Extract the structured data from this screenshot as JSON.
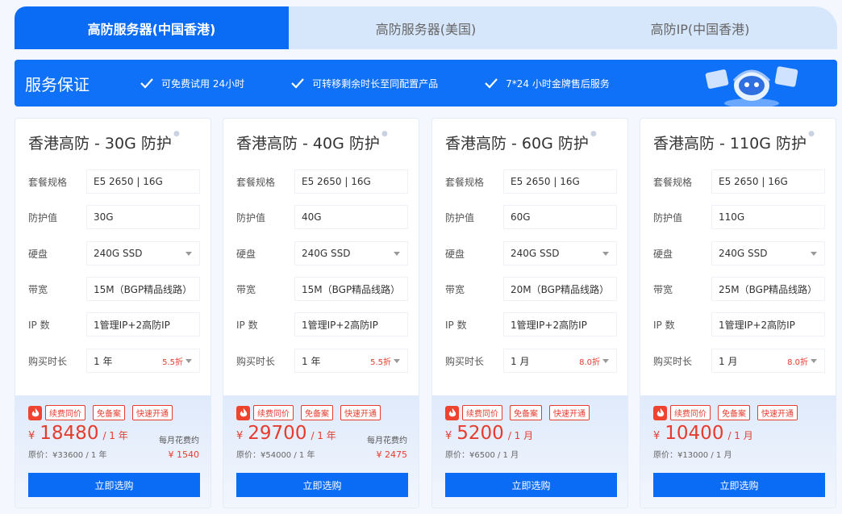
{
  "tabs": [
    "高防服务器(中国香港)",
    "高防服务器(美国)",
    "高防IP(中国香港)"
  ],
  "banner": {
    "title": "服务保证",
    "items": [
      "可免费试用 24小时",
      "可转移剩余时长至同配置产品",
      "7*24 小时金牌售后服务"
    ]
  },
  "labels": {
    "spec": "套餐规格",
    "protect": "防护值",
    "disk": "硬盘",
    "bandwidth": "带宽",
    "ip": "IP 数",
    "duration": "购买时长"
  },
  "badges": [
    "续费同价",
    "免备案",
    "快速开通"
  ],
  "currency": "¥",
  "buy_label": "立即选购",
  "monthly_label": "每月花费约",
  "cards": [
    {
      "title": "香港高防 - 30G 防护",
      "spec": "E5 2650 | 16G",
      "protect": "30G",
      "disk": "240G SSD",
      "bandwidth": "15M（BGP精品线路）",
      "ip": "1管理IP+2高防IP",
      "duration": "1 年",
      "discount": "5.5折",
      "price": "18480",
      "per": "/ 1 年",
      "original": "原价：¥33600 / 1 年",
      "monthly": "¥ 1540"
    },
    {
      "title": "香港高防 - 40G 防护",
      "spec": "E5 2650 | 16G",
      "protect": "40G",
      "disk": "240G SSD",
      "bandwidth": "15M（BGP精品线路）",
      "ip": "1管理IP+2高防IP",
      "duration": "1 年",
      "discount": "5.5折",
      "price": "29700",
      "per": "/ 1 年",
      "original": "原价：¥54000 / 1 年",
      "monthly": "¥ 2475"
    },
    {
      "title": "香港高防 - 60G 防护",
      "spec": "E5 2650 | 16G",
      "protect": "60G",
      "disk": "240G SSD",
      "bandwidth": "20M（BGP精品线路）",
      "ip": "1管理IP+2高防IP",
      "duration": "1 月",
      "discount": "8.0折",
      "price": "5200",
      "per": "/ 1 月",
      "original": "原价：¥6500 / 1 月",
      "monthly": ""
    },
    {
      "title": "香港高防 - 110G 防护",
      "spec": "E5 2650 | 16G",
      "protect": "110G",
      "disk": "240G SSD",
      "bandwidth": "25M（BGP精品线路）",
      "ip": "1管理IP+2高防IP",
      "duration": "1 月",
      "discount": "8.0折",
      "price": "10400",
      "per": "/ 1 月",
      "original": "原价：¥13000 / 1 月",
      "monthly": ""
    }
  ],
  "icons": {
    "check": "check-icon",
    "fire": "fire-icon",
    "mascot": "support-robot-illustration",
    "dropdown": "chevron-down-icon"
  },
  "colors": {
    "primary": "#0a6cf5",
    "accent_red": "#e63c2e",
    "tab_inactive": "#d6e6fb"
  }
}
